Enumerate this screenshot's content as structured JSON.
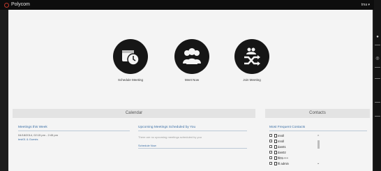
{
  "app": {
    "logo_text": "Polycom",
    "user_menu": "tma ▾"
  },
  "tiles": [
    {
      "label": "Schedule Meeting",
      "icon": "calendar-clock-icon"
    },
    {
      "label": "Meet Now",
      "icon": "people-icon"
    },
    {
      "label": "Join Meeting",
      "icon": "shuffle-people-icon"
    }
  ],
  "calendar": {
    "header": "Calendar",
    "meetings_week": {
      "title": "Meetings this Week",
      "item_time": "04/18/2014, 02:15 pm - 2:45 pm",
      "item_link": "test01 & Guests"
    },
    "upcoming": {
      "title": "Upcoming Meetings Scheduled by You",
      "empty_text": "There are no upcoming meetings scheduled by you",
      "view_all": "Schedule Now"
    }
  },
  "contacts": {
    "header": "Contacts",
    "most_frequent_title": "Most Frequent Contacts",
    "items": [
      "mroll",
      "mroll",
      "dan01",
      "dan02",
      "ftl01+++",
      "ftl admin"
    ]
  },
  "colors": {
    "accent": "#3a6ea5",
    "brand": "#c0392b",
    "dark": "#161616"
  }
}
